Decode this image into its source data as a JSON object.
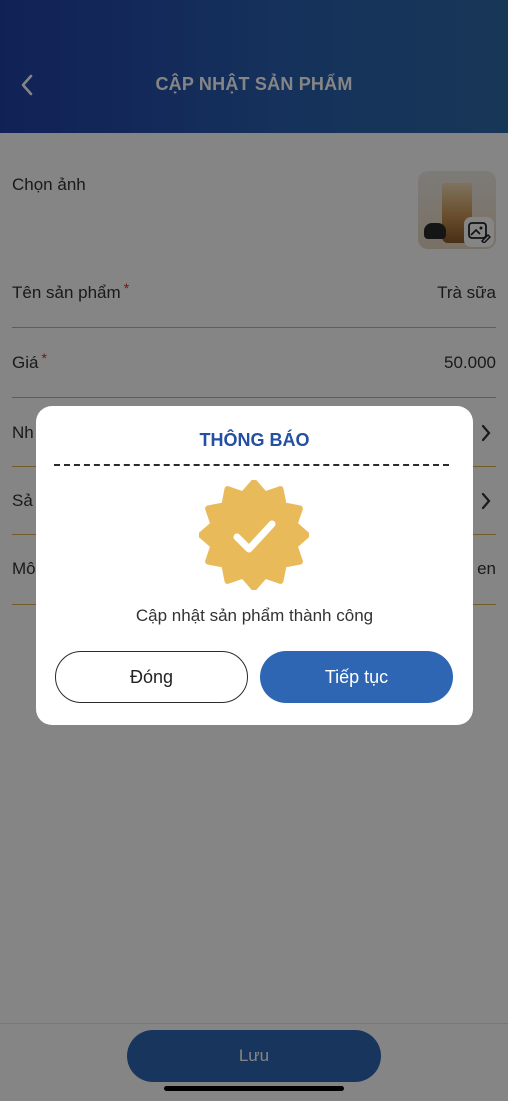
{
  "header": {
    "title": "CẬP NHẬT SẢN PHẨM"
  },
  "form": {
    "image_label": "Chọn ảnh",
    "name_label": "Tên sản phẩm",
    "name_value": "Trà sữa",
    "price_label": "Giá",
    "price_value": "50.000",
    "required_mark": "*",
    "group_label_partial": "Nh",
    "product_label_partial": "Sả",
    "description_label_partial": "Mô",
    "description_value_partial": "en"
  },
  "footer": {
    "save_label": "Lưu"
  },
  "dialog": {
    "title": "THÔNG BÁO",
    "message": "Cập nhật sản phẩm thành công",
    "close_label": "Đóng",
    "continue_label": "Tiếp tục",
    "badge_color": "#e9ba5a",
    "primary_color": "#2f66b3"
  },
  "icons": {
    "back": "chevron-left-icon",
    "chevron": "chevron-right-icon",
    "edit_image": "edit-image-icon",
    "success": "check-badge-icon"
  }
}
